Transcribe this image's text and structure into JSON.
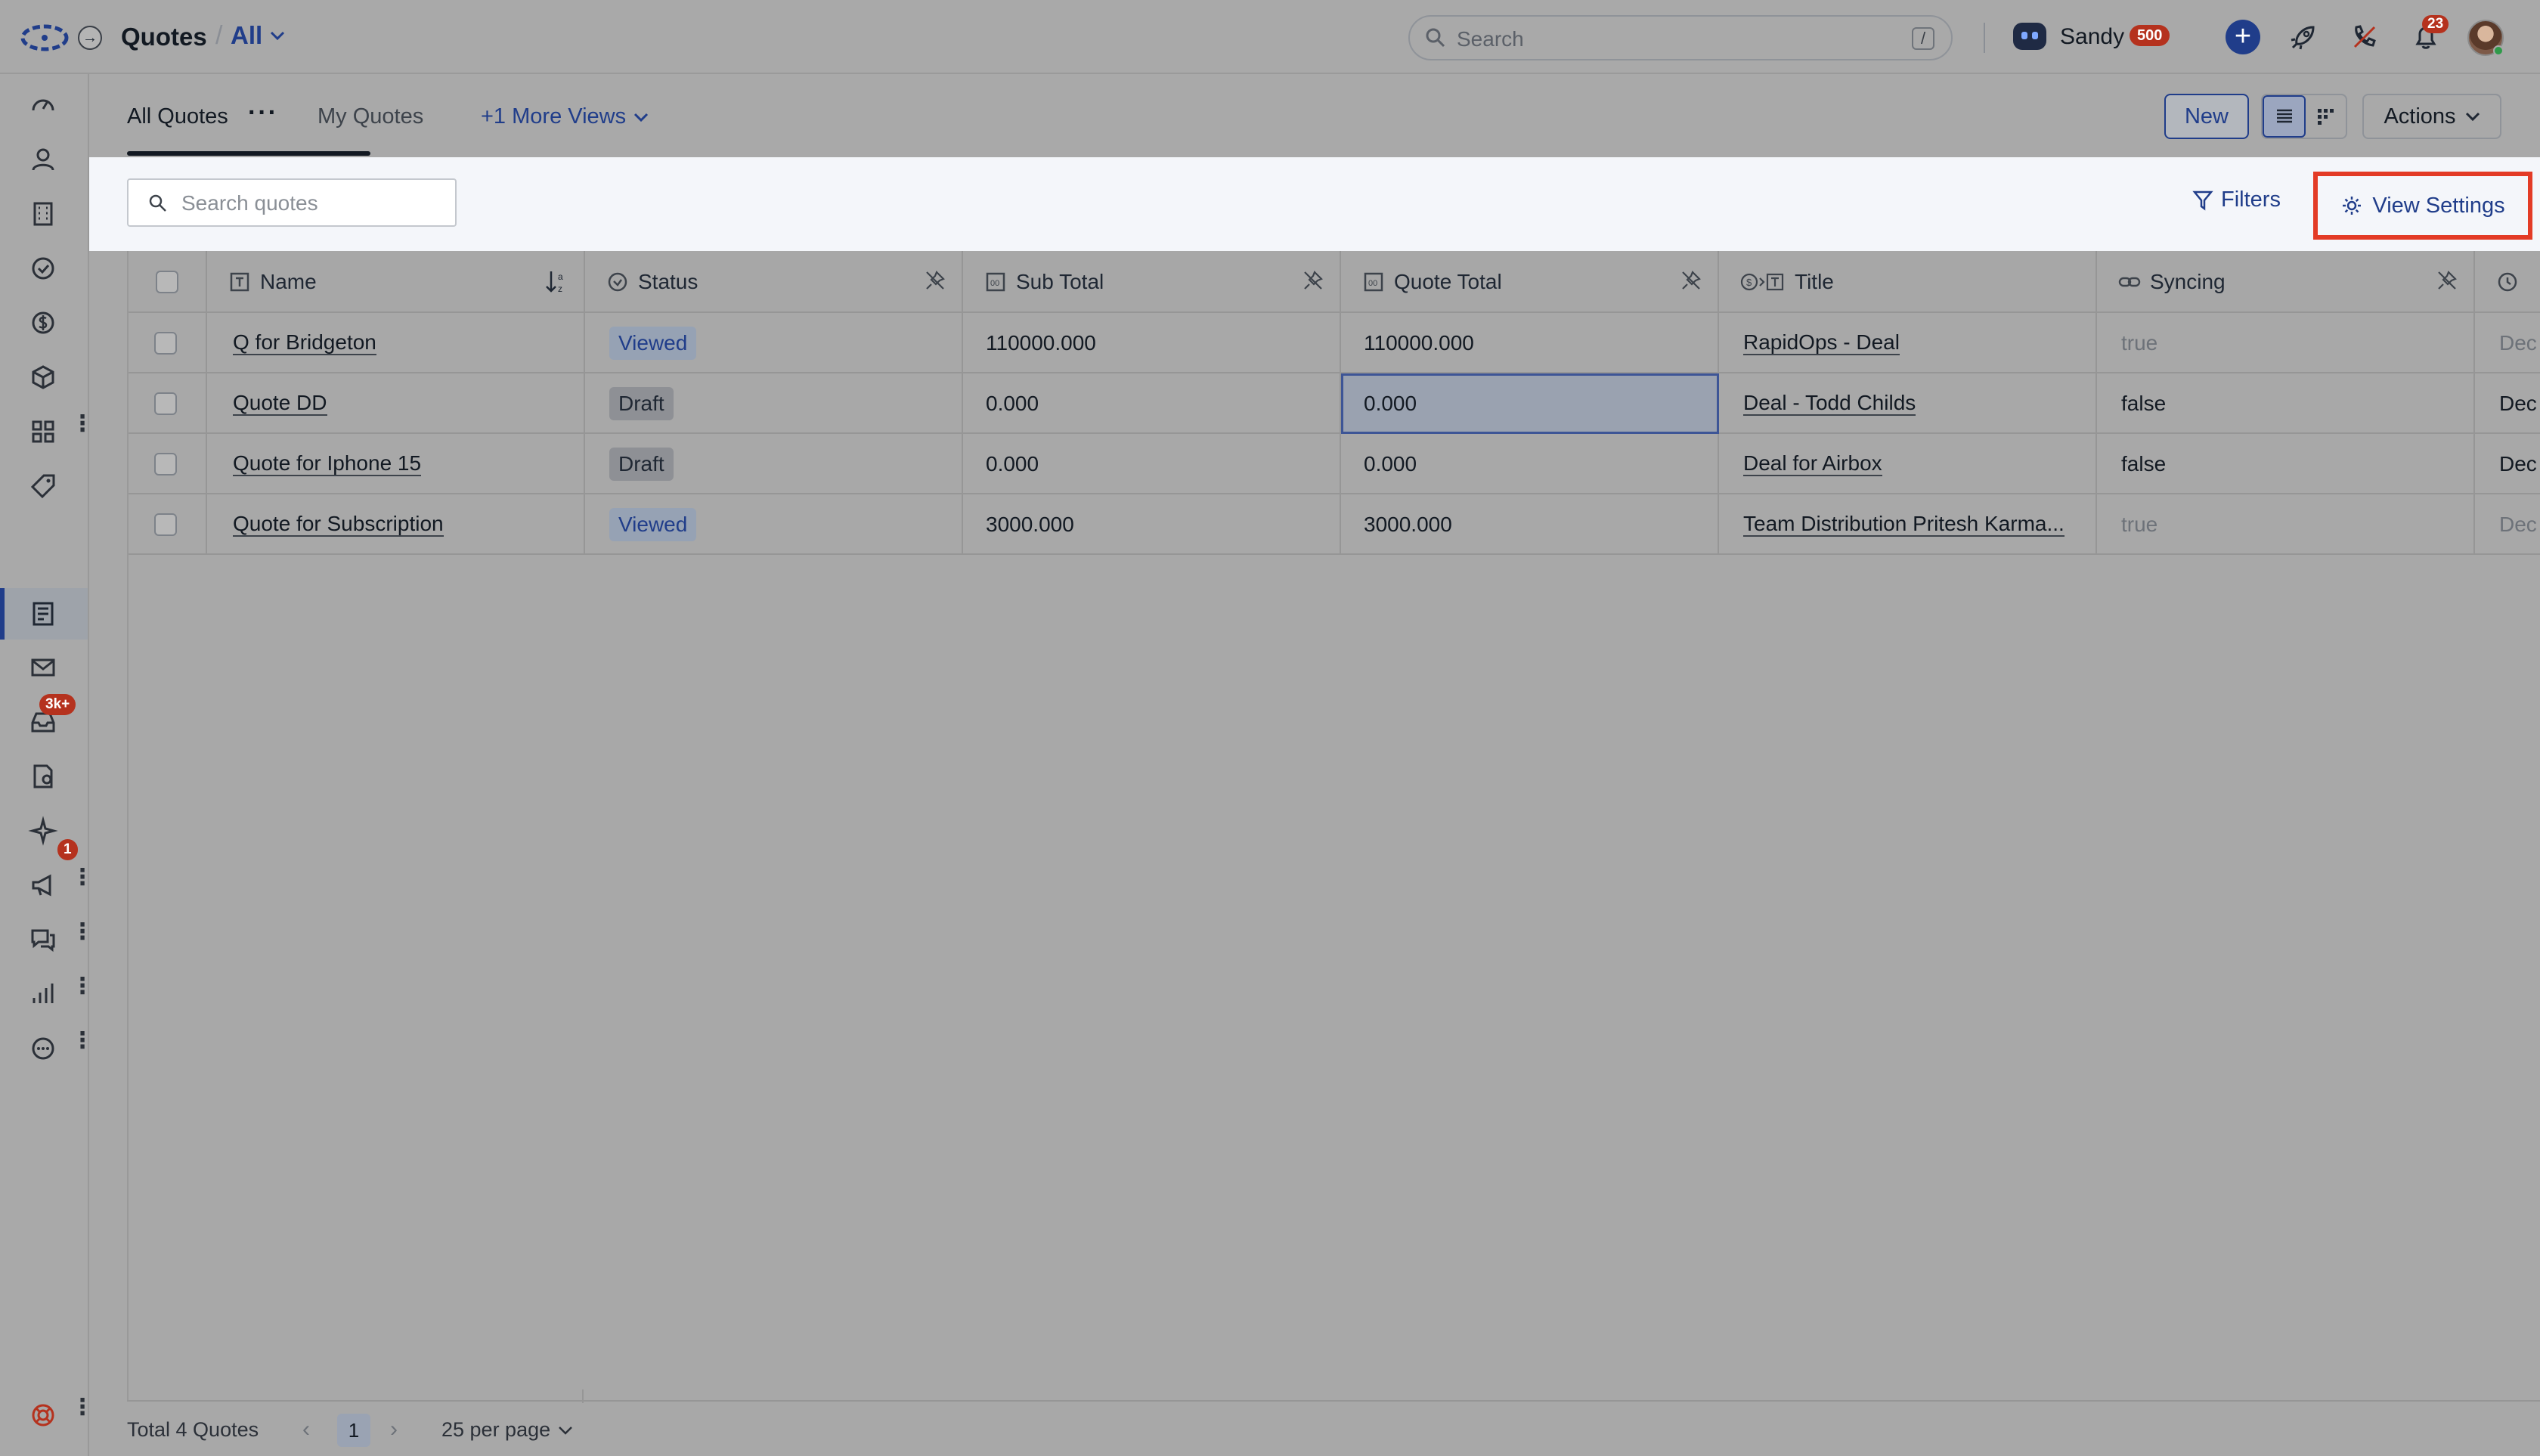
{
  "header": {
    "page_title": "Quotes",
    "separator": "/",
    "view_filter": "All",
    "search_placeholder": "Search",
    "search_shortcut": "/",
    "user_name": "Sandy",
    "user_points": "500",
    "notification_count": "23"
  },
  "sidebar": {
    "items": [
      {
        "icon": "dashboard-gauge-icon"
      },
      {
        "icon": "contacts-person-icon"
      },
      {
        "icon": "companies-building-icon"
      },
      {
        "icon": "tasks-check-icon"
      },
      {
        "icon": "deals-dollar-icon"
      },
      {
        "icon": "products-box-icon"
      },
      {
        "icon": "apps-grid-icon"
      },
      {
        "icon": "tags-icon"
      },
      {
        "icon": "quotes-document-icon"
      },
      {
        "icon": "email-envelope-icon"
      },
      {
        "icon": "inbox-icon"
      },
      {
        "icon": "documents-icon"
      },
      {
        "icon": "automation-sparkle-icon"
      },
      {
        "icon": "campaigns-megaphone-icon"
      },
      {
        "icon": "conversations-chat-icon"
      },
      {
        "icon": "reports-chart-icon"
      },
      {
        "icon": "more-circle-icon"
      },
      {
        "icon": "help-lifebuoy-icon"
      }
    ],
    "inbox_badge": "3k+",
    "chat_badge": "1"
  },
  "tabs": {
    "all_quotes": "All Quotes",
    "my_quotes": "My Quotes",
    "more_views": "+1 More Views",
    "new_button": "New",
    "actions_button": "Actions"
  },
  "toolbar": {
    "search_placeholder": "Search quotes",
    "filters_label": "Filters",
    "view_settings_label": "View Settings"
  },
  "table": {
    "columns": [
      "Name",
      "Status",
      "Sub Total",
      "Quote Total",
      "Title",
      "Syncing"
    ],
    "rows": [
      {
        "name": "Q for Bridgeton",
        "status": "Viewed",
        "sub_total": "110000.000",
        "quote_total": "110000.000",
        "title": "RapidOps - Deal",
        "syncing": "true",
        "next": "Dec"
      },
      {
        "name": "Quote DD",
        "status": "Draft",
        "sub_total": "0.000",
        "quote_total": "0.000",
        "title": "Deal - Todd Childs",
        "syncing": "false",
        "next": "Dec"
      },
      {
        "name": "Quote for Iphone 15",
        "status": "Draft",
        "sub_total": "0.000",
        "quote_total": "0.000",
        "title": "Deal for Airbox",
        "syncing": "false",
        "next": "Dec"
      },
      {
        "name": "Quote for Subscription",
        "status": "Viewed",
        "sub_total": "3000.000",
        "quote_total": "3000.000",
        "title": "Team Distribution Pritesh Karma...",
        "syncing": "true",
        "next": "Dec"
      }
    ]
  },
  "footer": {
    "total_label": "Total 4 Quotes",
    "current_page": "1",
    "per_page": "25 per page"
  },
  "colors": {
    "accent": "#203d8a",
    "highlight_border": "#e33b26",
    "badge_red": "#b5321e"
  }
}
